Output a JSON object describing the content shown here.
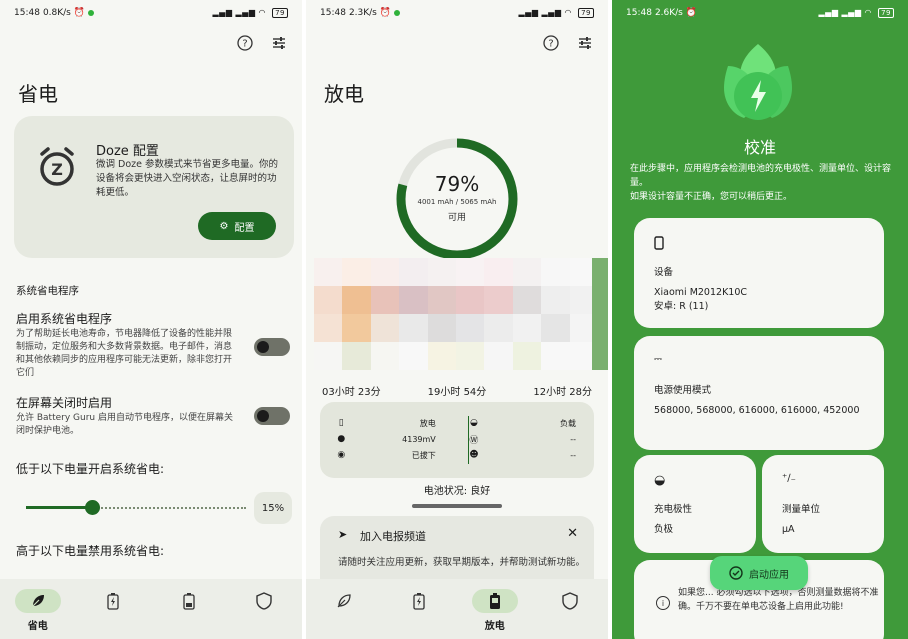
{
  "panel1": {
    "status": {
      "time": "15:48",
      "speed": "0.8K/s",
      "battery": "79"
    },
    "title": "省电",
    "doze": {
      "title": "Doze 配置",
      "description": "微调 Doze 参数模式来节省更多电量。你的设备将会更快进入空闲状态，让息屏时的功耗更低。",
      "button": "配置"
    },
    "section": "系统省电程序",
    "option1": {
      "title": "启用系统省电程序",
      "description": "为了帮助延长电池寿命，节电器降低了设备的性能并限制振动，定位服务和大多数背景数据。电子邮件，消息和其他依赖同步的应用程序可能无法更新，除非您打开它们"
    },
    "option2": {
      "title": "在屏幕关闭时启用",
      "description": "允许 Battery Guru 启用自动节电程序，以便在屏幕关闭时保护电池。"
    },
    "below_label": "低于以下电量开启系统省电:",
    "below_value": "15%",
    "above_label": "高于以下电量禁用系统省电:",
    "nav": {
      "active_label": "省电"
    }
  },
  "panel2": {
    "status": {
      "time": "15:48",
      "speed": "2.3K/s",
      "battery": "79"
    },
    "title": "放电",
    "ring": {
      "percent": "79%",
      "capacity": "4001 mAh / 5065 mAh",
      "available": "可用",
      "fraction": 0.79
    },
    "times": [
      "03小时 23分",
      "19小时 54分",
      "12小时 28分"
    ],
    "stats": {
      "discharge": "放电",
      "voltage": "4139mV",
      "unplugged": "已拔下",
      "load": "负载",
      "dash1": "--",
      "dash2": "--"
    },
    "health": "电池状况: 良好",
    "join": {
      "title": "加入电报频道",
      "description": "请随时关注应用更新，获取早期版本，并帮助测试新功能。"
    },
    "nav": {
      "active_label": "放电"
    }
  },
  "panel3": {
    "status": {
      "time": "15:48",
      "speed": "2.6K/s",
      "battery": "79"
    },
    "title": "校准",
    "description": "在此步骤中，应用程序会检测电池的充电极性、测量单位、设计容量。\n如果设计容量不正确，您可以稍后更正。",
    "device": {
      "label": "设备",
      "model": "Xiaomi M2012K10C",
      "android": "安卓: R (11)"
    },
    "power_mode": {
      "label": "电源使用模式",
      "value": "568000, 568000, 616000, 616000, 452000"
    },
    "polarity": {
      "label": "充电极性",
      "value": "负极"
    },
    "unit": {
      "label": "测量单位",
      "value": "μA"
    },
    "launch": "启动应用",
    "warning": "如果您... 必须勾选以下选项，否则测量数据将不准确。千万不要在单电芯设备上启用此功能!"
  },
  "colors": {
    "accent": "#1f6a24",
    "green_bg": "#3f9a3a",
    "card": "#e6e9e0"
  }
}
